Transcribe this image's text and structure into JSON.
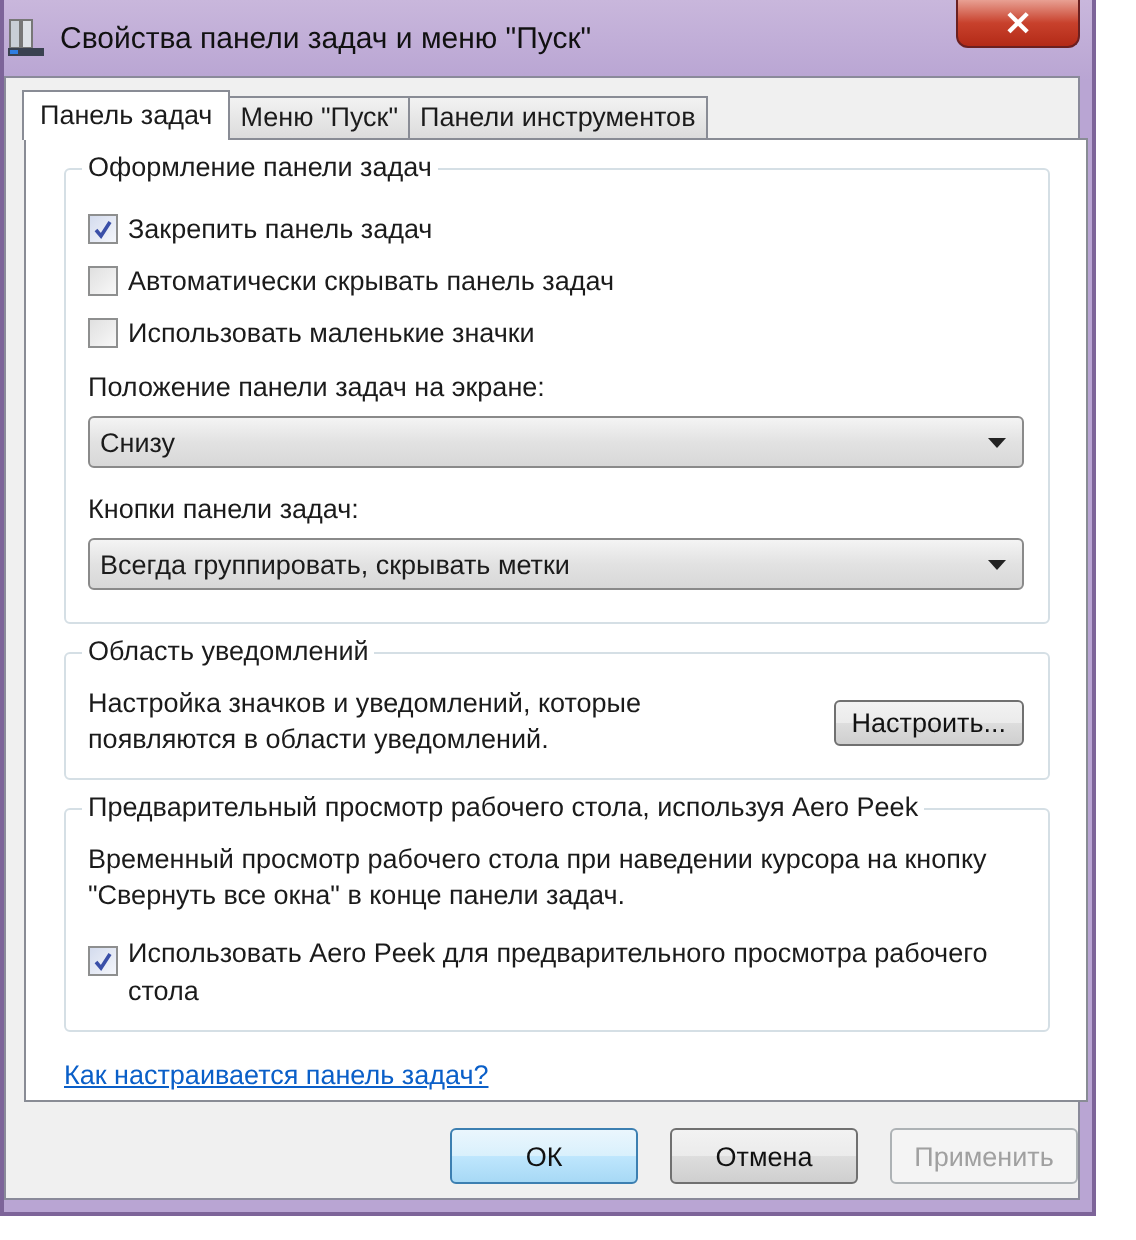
{
  "window": {
    "title": "Свойства панели задач и меню \"Пуск\"",
    "close": "×"
  },
  "tabs": [
    {
      "label": "Панель задач",
      "selected": true
    },
    {
      "label": "Меню \"Пуск\"",
      "selected": false
    },
    {
      "label": "Панели инструментов",
      "selected": false
    }
  ],
  "appearance": {
    "title": "Оформление панели задач",
    "checkboxes": [
      {
        "label": "Закрепить панель задач",
        "checked": true
      },
      {
        "label": "Автоматически скрывать панель задач",
        "checked": false
      },
      {
        "label": "Использовать маленькие значки",
        "checked": false
      }
    ],
    "position": {
      "label": "Положение панели задач на экране:",
      "value": "Снизу"
    },
    "buttons_mode": {
      "label": "Кнопки панели задач:",
      "value": "Всегда группировать, скрывать метки"
    }
  },
  "notifications": {
    "title": "Область уведомлений",
    "text": "Настройка значков и уведомлений, которые появляются в области уведомлений.",
    "button": "Настроить..."
  },
  "aero_peek": {
    "title": "Предварительный просмотр рабочего стола, используя Aero Peek",
    "text": "Временный просмотр рабочего стола при наведении курсора на кнопку \"Свернуть все окна\" в конце панели задач.",
    "checkbox": {
      "label": "Использовать Aero Peek для предварительного просмотра рабочего стола",
      "checked": true
    }
  },
  "help_link": "Как настраивается панель задач?",
  "buttons": [
    {
      "label": "ОК",
      "default": true,
      "disabled": false
    },
    {
      "label": "Отмена",
      "default": false,
      "disabled": false
    },
    {
      "label": "Применить",
      "default": false,
      "disabled": true
    }
  ]
}
